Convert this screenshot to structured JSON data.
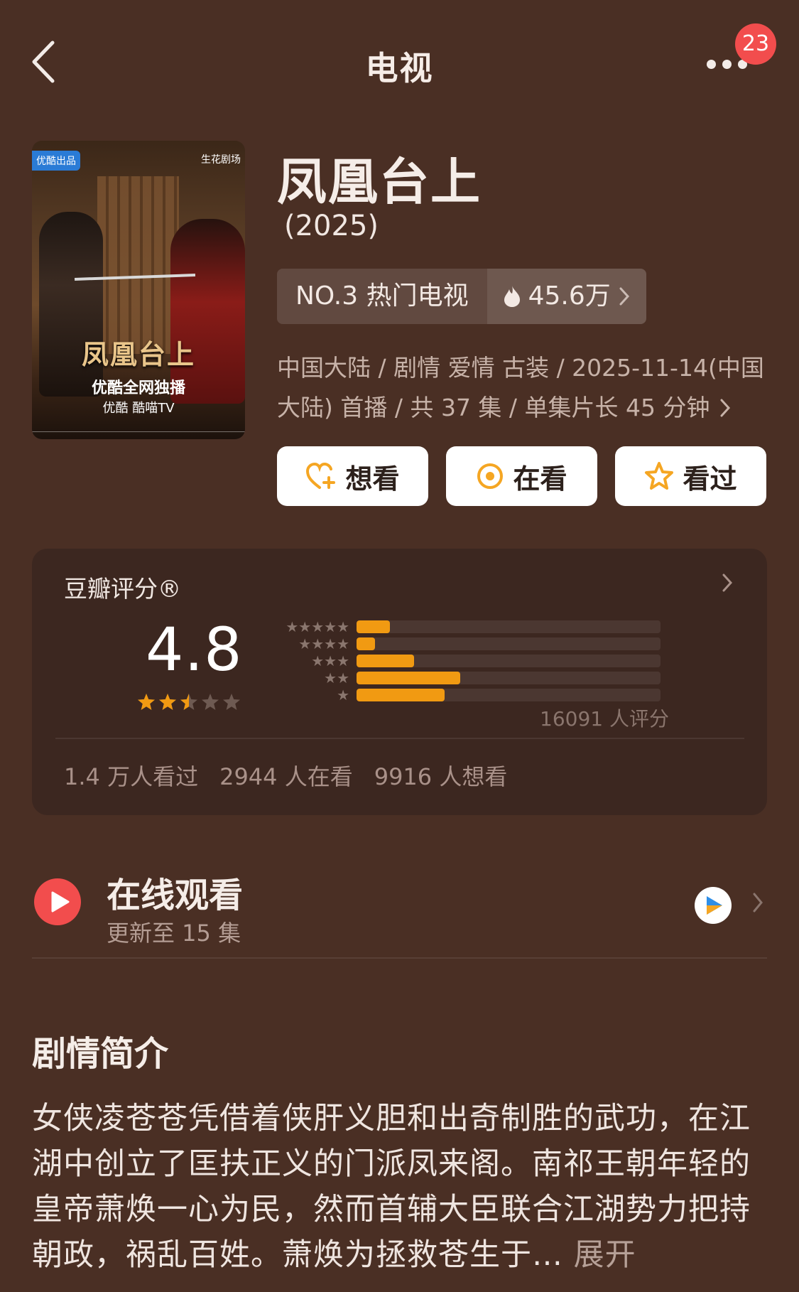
{
  "nav": {
    "title": "电视",
    "notification_count": "23"
  },
  "poster": {
    "tag": "优酷出品",
    "brand": "生花剧场",
    "title": "凤凰台上",
    "slogan": "优酷全网独播",
    "platforms": "优酷 酷喵TV"
  },
  "show": {
    "title": "凤凰台上",
    "year": "(2025)",
    "rank_label": "NO.3 热门电视",
    "heat": "45.6万",
    "meta_line1": "中国大陆 / 剧情 爱情 古装 / 2025-11-14(中国",
    "meta_line2": "大陆) 首播 / 共 37 集 / 单集片长 45 分钟"
  },
  "actions": {
    "want": "想看",
    "watching": "在看",
    "watched": "看过"
  },
  "rating": {
    "label": "豆瓣评分®",
    "score": "4.8",
    "star_value": 2.5,
    "max_stars": 5,
    "distribution": [
      {
        "stars": 5,
        "fraction": 0.11
      },
      {
        "stars": 4,
        "fraction": 0.06
      },
      {
        "stars": 3,
        "fraction": 0.19
      },
      {
        "stars": 2,
        "fraction": 0.34
      },
      {
        "stars": 1,
        "fraction": 0.29
      }
    ],
    "count_text": "16091 人评分",
    "stats": {
      "watched": "1.4 万人看过",
      "watching": "2944 人在看",
      "want": "9916 人想看"
    }
  },
  "online": {
    "title": "在线观看",
    "subtitle": "更新至 15 集"
  },
  "synopsis": {
    "heading": "剧情简介",
    "text": "女侠凌苍苍凭借着侠肝义胆和出奇制胜的武功，在江湖中创立了匡扶正义的门派凤来阁。南祁王朝年轻的皇帝萧焕一心为民，然而首辅大臣联合江湖势力把持朝政，祸乱百姓。萧焕为拯救苍生于…",
    "more_label": "展开"
  },
  "colors": {
    "background": "#4a2f24",
    "accent_orange": "#f19a12",
    "accent_red": "#f24d4d"
  },
  "icons": [
    "back-chevron-icon",
    "more-dots-icon",
    "fire-icon",
    "heart-plus-icon",
    "target-icon",
    "star-icon",
    "play-icon",
    "youku-icon",
    "chevron-right-icon"
  ]
}
